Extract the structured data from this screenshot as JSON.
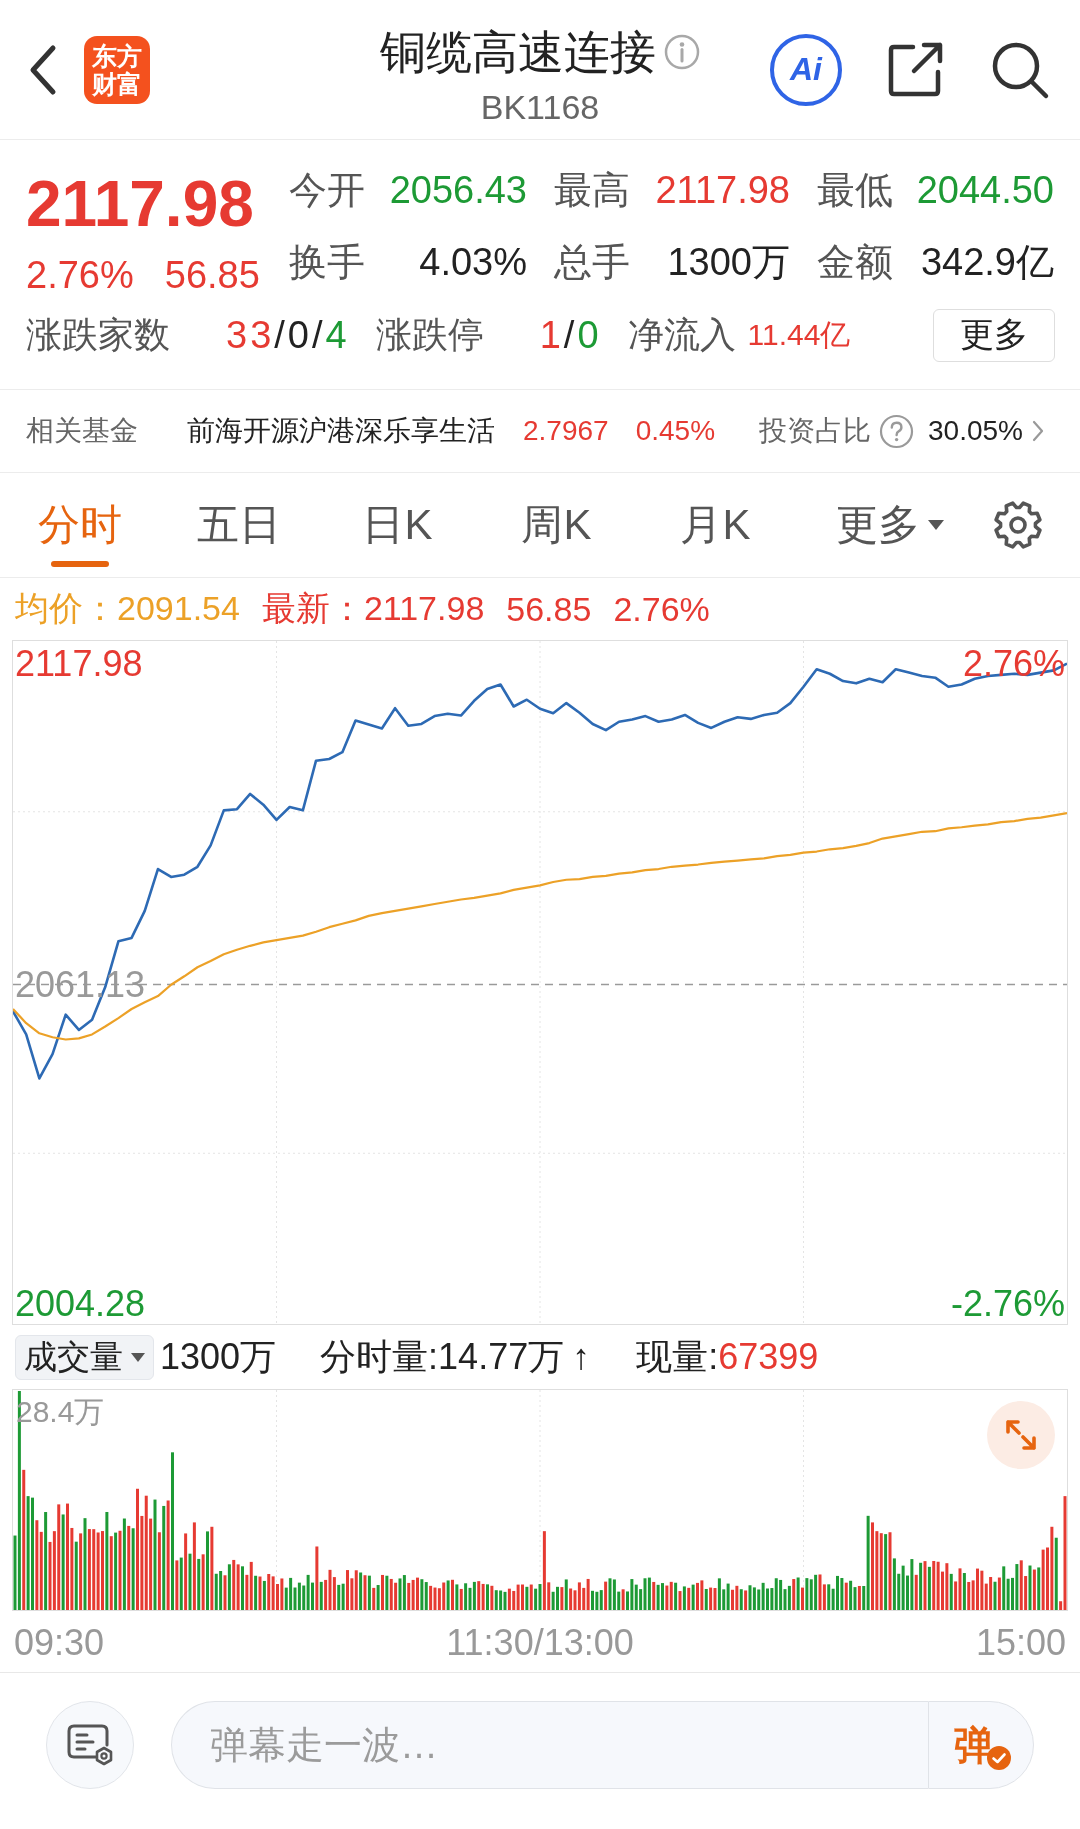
{
  "header": {
    "logo": "东方财富",
    "title": "铜缆高速连接",
    "code": "BK1168",
    "ai_button": "Ai"
  },
  "quote": {
    "price": "2117.98",
    "change_percent": "2.76%",
    "change": "56.85",
    "color": "#e63a32",
    "stats": [
      {
        "label": "今开",
        "value": "2056.43",
        "color": "#1d9a35"
      },
      {
        "label": "最高",
        "value": "2117.98",
        "color": "#e63a32"
      },
      {
        "label": "最低",
        "value": "2044.50",
        "color": "#1d9a35"
      },
      {
        "label": "换手",
        "value": "4.03%",
        "color": "#222222"
      },
      {
        "label": "总手",
        "value": "1300万",
        "color": "#222222"
      },
      {
        "label": "金额",
        "value": "342.9亿",
        "color": "#222222"
      }
    ],
    "breadth": [
      {
        "label": "涨跌家数",
        "kind": "ratio",
        "parts": [
          {
            "text": "33",
            "color": "#e63a32"
          },
          {
            "text": "/",
            "color": "#222222"
          },
          {
            "text": "0",
            "color": "#222222"
          },
          {
            "text": "/",
            "color": "#222222"
          },
          {
            "text": "4",
            "color": "#1d9a35"
          }
        ]
      },
      {
        "label": "涨跌停",
        "kind": "ratio",
        "parts": [
          {
            "text": "1",
            "color": "#e63a32"
          },
          {
            "text": "/",
            "color": "#222222"
          },
          {
            "text": "0",
            "color": "#1d9a35"
          }
        ]
      },
      {
        "label": "净流入",
        "kind": "amount",
        "parts": [
          {
            "text": "11.44亿",
            "color": "#e63a32"
          }
        ]
      }
    ],
    "more_button": "更多"
  },
  "fund": {
    "label": "相关基金",
    "name": "前海开源沪港深乐享生活",
    "price": "2.7967",
    "change_percent": "0.45%",
    "color": "#e63a32",
    "ratio_label": "投资占比",
    "ratio": "30.05%"
  },
  "tabs": [
    {
      "label": "分时",
      "kind": "tab",
      "selected": true
    },
    {
      "label": "五日",
      "kind": "tab",
      "selected": false
    },
    {
      "label": "日K",
      "kind": "tab",
      "selected": false
    },
    {
      "label": "周K",
      "kind": "tab",
      "selected": false
    },
    {
      "label": "月K",
      "kind": "tab",
      "selected": false
    },
    {
      "label": "更多",
      "kind": "dropdown",
      "selected": false
    }
  ],
  "legend": [
    {
      "text": "均价：2091.54",
      "color": "#eca127"
    },
    {
      "text": "最新：2117.98",
      "color": "#e63a32"
    },
    {
      "text": "56.85",
      "color": "#e63a32"
    },
    {
      "text": "2.76%",
      "color": "#e63a32"
    }
  ],
  "chart": {
    "chart_data": {
      "type": "line",
      "categories": [
        null,
        null,
        null,
        null,
        null,
        null,
        null,
        null,
        null,
        null,
        null,
        null,
        null,
        null,
        null,
        null,
        null,
        null,
        null,
        null,
        null,
        null,
        null,
        null,
        null,
        null,
        null,
        null,
        null,
        null,
        null,
        null,
        null,
        null,
        null,
        null,
        null,
        null,
        null,
        null,
        null,
        null,
        null,
        null,
        null,
        null,
        null,
        null,
        null,
        null,
        null,
        null,
        null,
        null,
        null,
        null,
        null,
        null,
        null,
        null,
        null,
        null,
        null,
        null,
        null,
        null,
        null,
        null,
        null,
        null,
        null,
        null,
        null,
        null,
        null,
        null,
        null,
        null,
        null,
        null,
        null
      ],
      "ylim": [
        2001,
        2122
      ],
      "yticks": [
        {
          "value": 2117.98,
          "label": "2117.98"
        },
        {
          "value": 2061.13,
          "label": "2061.13"
        },
        {
          "value": 2004.28,
          "label": "2004.28"
        }
      ],
      "grid": true,
      "ref_lines": [
        {
          "axis": "y",
          "value": 2061.13
        }
      ],
      "series": [
        {
          "color": "#2d6ab4",
          "values": [
            2056.4,
            2052.3,
            2044.5,
            2048.8,
            2055.8,
            2053.1,
            2054.9,
            2060.7,
            2068.8,
            2069.4,
            2074.2,
            2081.6,
            2080.2,
            2080.6,
            2082.0,
            2085.8,
            2092.0,
            2092.2,
            2094.9,
            2093.0,
            2090.3,
            2092.6,
            2092.0,
            2100.8,
            2101.1,
            2102.3,
            2107.9,
            2107.2,
            2106.5,
            2110.1,
            2107.0,
            2107.3,
            2108.7,
            2109.1,
            2108.8,
            2111.4,
            2113.5,
            2114.3,
            2110.4,
            2111.6,
            2110.0,
            2109.2,
            2111.0,
            2109.3,
            2107.3,
            2106.2,
            2107.7,
            2108.1,
            2108.7,
            2107.7,
            2108.1,
            2108.9,
            2107.5,
            2106.6,
            2107.7,
            2108.5,
            2108.2,
            2108.9,
            2109.3,
            2111.0,
            2113.9,
            2117.0,
            2116.2,
            2114.9,
            2114.5,
            2115.3,
            2114.7,
            2117.0,
            2116.4,
            2115.8,
            2115.5,
            2113.9,
            2114.3,
            2115.3,
            2115.8,
            2116.0,
            2116.2,
            2116.0,
            2116.4,
            2116.8,
            2118.0
          ]
        },
        {
          "color": "#eca127",
          "values": [
            2056.8,
            2054.3,
            2052.5,
            2051.8,
            2051.4,
            2051.6,
            2052.3,
            2053.7,
            2055.2,
            2056.8,
            2058.0,
            2059.1,
            2061.1,
            2062.6,
            2064.2,
            2065.3,
            2066.5,
            2067.3,
            2068.0,
            2068.6,
            2069.0,
            2069.4,
            2069.8,
            2070.5,
            2071.3,
            2071.9,
            2072.5,
            2073.3,
            2073.8,
            2074.2,
            2074.6,
            2075.0,
            2075.4,
            2075.8,
            2076.2,
            2076.5,
            2076.9,
            2077.3,
            2077.9,
            2078.3,
            2078.7,
            2079.3,
            2079.7,
            2079.8,
            2080.2,
            2080.4,
            2080.8,
            2081.0,
            2081.4,
            2081.6,
            2082.0,
            2082.2,
            2082.4,
            2082.7,
            2082.9,
            2083.1,
            2083.3,
            2083.5,
            2083.9,
            2084.1,
            2084.5,
            2084.7,
            2085.1,
            2085.3,
            2085.7,
            2086.2,
            2087.0,
            2087.4,
            2087.8,
            2088.2,
            2088.3,
            2088.8,
            2089.0,
            2089.3,
            2089.5,
            2089.9,
            2090.1,
            2090.5,
            2090.7,
            2091.1,
            2091.5
          ]
        }
      ]
    },
    "right_labels": [
      "2.76%",
      "-2.76%"
    ]
  },
  "volume": {
    "selector": "成交量",
    "total": "1300万",
    "interval": "分时量:14.77万",
    "interval_arrow": "↑",
    "current_label": "现量:",
    "current_value": "67399",
    "max_label": "28.4万"
  },
  "time_axis": [
    "09:30",
    "11:30/13:00",
    "15:00"
  ],
  "comment_bar": {
    "placeholder": "弹幕走一波…",
    "toggle": "弹",
    "toggle_on": true
  }
}
